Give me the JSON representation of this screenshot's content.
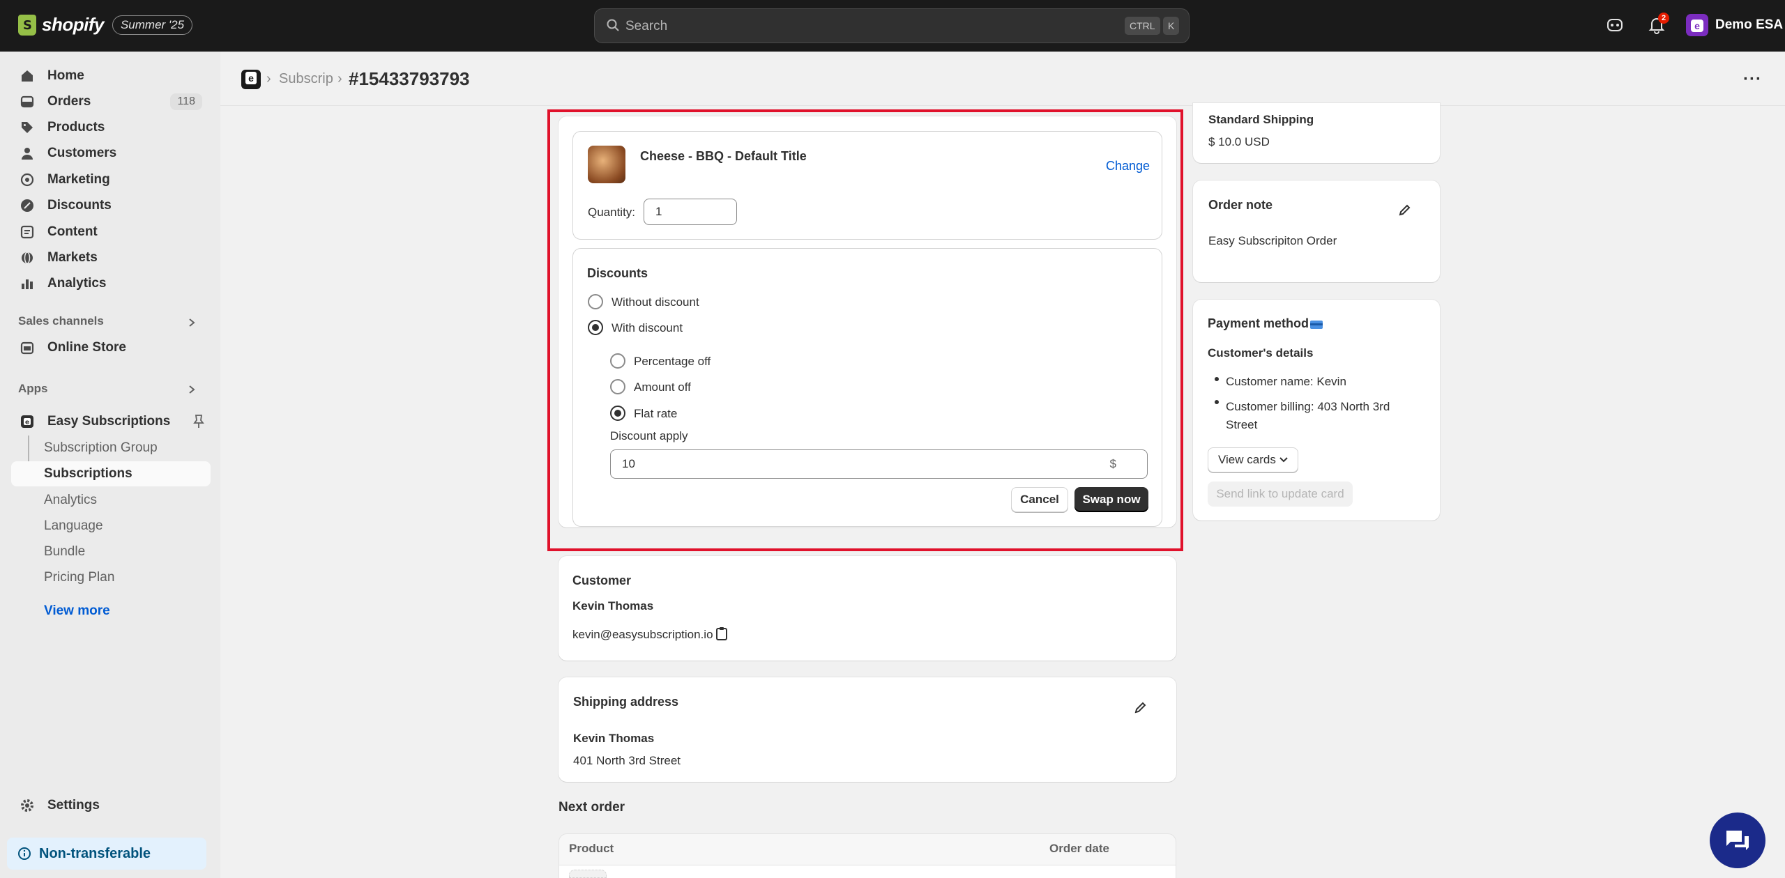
{
  "topbar": {
    "logo_text": "shopify",
    "edition_badge": "Summer '25",
    "search_placeholder": "Search",
    "kbd_ctrl": "CTRL",
    "kbd_k": "K",
    "notification_count": "2",
    "store_name": "Demo ESA",
    "store_avatar_letter": "e"
  },
  "sidebar": {
    "nav": [
      {
        "label": "Home",
        "icon": "home-icon"
      },
      {
        "label": "Orders",
        "icon": "orders-icon",
        "count": "118"
      },
      {
        "label": "Products",
        "icon": "tag-icon"
      },
      {
        "label": "Customers",
        "icon": "person-icon"
      },
      {
        "label": "Marketing",
        "icon": "target-icon"
      },
      {
        "label": "Discounts",
        "icon": "discount-icon"
      },
      {
        "label": "Content",
        "icon": "content-icon"
      },
      {
        "label": "Markets",
        "icon": "globe-icon"
      },
      {
        "label": "Analytics",
        "icon": "bar-chart-icon"
      }
    ],
    "sales_channels_title": "Sales channels",
    "online_store": "Online Store",
    "apps_title": "Apps",
    "app_name": "Easy Subscriptions",
    "app_sub_items": [
      "Subscription Group",
      "Subscriptions",
      "Analytics",
      "Language",
      "Bundle",
      "Pricing Plan"
    ],
    "view_more": "View more",
    "settings": "Settings",
    "non_transferable": "Non-transferable"
  },
  "header": {
    "breadcrumb": "Subscriptions",
    "title": "#15433793793"
  },
  "swap_card": {
    "product_title": "Cheese - BBQ - Default Title",
    "change_label": "Change",
    "quantity_label": "Quantity:",
    "quantity_value": "1",
    "discounts_title": "Discounts",
    "without_discount": "Without discount",
    "with_discount": "With discount",
    "percentage_off": "Percentage off",
    "amount_off": "Amount off",
    "flat_rate": "Flat rate",
    "discount_apply_label": "Discount apply",
    "discount_value": "10",
    "currency_suffix": "$",
    "cancel_label": "Cancel",
    "swap_label": "Swap now"
  },
  "customer_card": {
    "title": "Customer",
    "name": "Kevin Thomas",
    "email": "kevin@easysubscription.io"
  },
  "shipping_card": {
    "title": "Shipping address",
    "name": "Kevin Thomas",
    "address": "401 North 3rd Street"
  },
  "next_order": {
    "title": "Next order",
    "columns": [
      "Product",
      "Order date"
    ]
  },
  "right": {
    "shipping_method": "Standard Shipping",
    "shipping_price": "$ 10.0 USD",
    "order_note_title": "Order note",
    "order_note_text": "Easy Subscripiton Order",
    "payment_title": "Payment method",
    "customer_details_title": "Customer's details",
    "customer_name_line": "Customer name: Kevin",
    "customer_billing_line": "Customer billing: 403 North 3rd Street",
    "view_cards_label": "View cards",
    "send_link_label": "Send link to update card"
  }
}
